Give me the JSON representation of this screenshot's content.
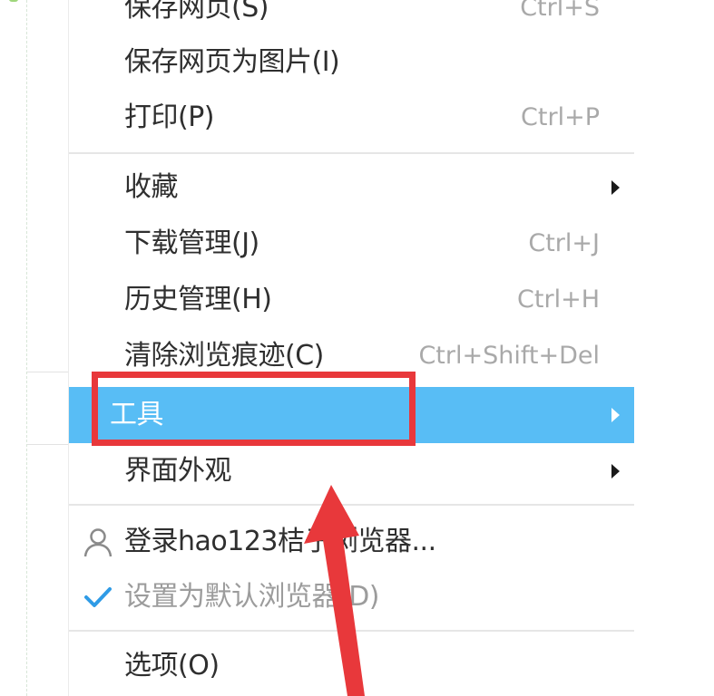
{
  "menu": {
    "items": [
      {
        "label": "保存网页(S)",
        "shortcut": "Ctrl+S"
      },
      {
        "label": "保存网页为图片(I)",
        "shortcut": ""
      },
      {
        "label": "打印(P)",
        "shortcut": "Ctrl+P"
      },
      {
        "label": "收藏",
        "shortcut": ""
      },
      {
        "label": "下载管理(J)",
        "shortcut": "Ctrl+J"
      },
      {
        "label": "历史管理(H)",
        "shortcut": "Ctrl+H"
      },
      {
        "label": "清除浏览痕迹(C)",
        "shortcut": "Ctrl+Shift+Del"
      },
      {
        "label": "工具",
        "shortcut": ""
      },
      {
        "label": "界面外观",
        "shortcut": ""
      },
      {
        "label": "登录hao123桔子浏览器...",
        "shortcut": ""
      },
      {
        "label": "设置为默认浏览器(D)",
        "shortcut": ""
      },
      {
        "label": "选项(O)",
        "shortcut": ""
      }
    ]
  },
  "colors": {
    "highlight": "#58bdf5",
    "annotation_red": "#e8383b",
    "check_blue": "#2f9be6"
  },
  "icons": {
    "submenu_arrow": "chevron-right-icon",
    "user": "user-icon",
    "check": "check-icon"
  }
}
